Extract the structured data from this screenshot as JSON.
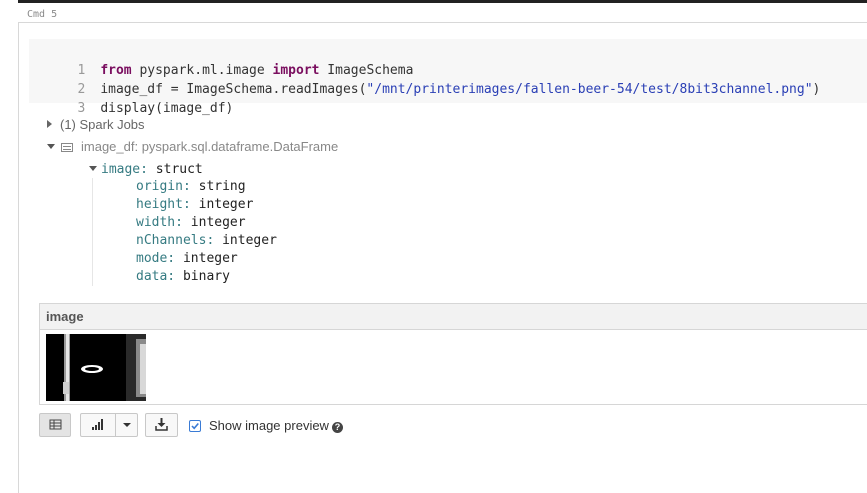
{
  "cell": {
    "cmd_label": "Cmd 5",
    "code_lines": [
      {
        "num": "1",
        "kw1": "from",
        "t1": " pyspark.ml.image ",
        "kw2": "import",
        "t2": " ImageSchema",
        "t3": "",
        "str": "",
        "t4": ""
      },
      {
        "num": "2",
        "kw1": "",
        "t1": "",
        "kw2": "",
        "t2": "",
        "t3": "image_df = ImageSchema.readImages(",
        "str": "\"/mnt/printerimages/fallen-beer-54/test/8bit3channel.png\"",
        "t4": ")"
      },
      {
        "num": "3",
        "kw1": "",
        "t1": "",
        "kw2": "",
        "t2": "",
        "t3": "display(image_df)",
        "str": "",
        "t4": ""
      }
    ]
  },
  "output": {
    "spark_jobs_label": "(1) Spark Jobs",
    "dataframe_label": "image_df:  pyspark.sql.dataframe.DataFrame",
    "schema": {
      "root_name": "image:",
      "root_type": " struct",
      "fields": [
        {
          "name": "origin:",
          "type": " string"
        },
        {
          "name": "height:",
          "type": " integer"
        },
        {
          "name": "width:",
          "type": " integer"
        },
        {
          "name": "nChannels:",
          "type": " integer"
        },
        {
          "name": "mode:",
          "type": " integer"
        },
        {
          "name": "data:",
          "type": " binary"
        }
      ]
    },
    "table": {
      "column_header": "image"
    }
  },
  "toolbar": {
    "table_view_icon": "table-icon",
    "chart_icon": "bar-chart-icon",
    "dropdown_icon": "caret-down-icon",
    "download_icon": "download-icon",
    "show_preview_label": "Show image preview",
    "show_preview_checked": true
  },
  "colors": {
    "keyword": "#7a0e5f",
    "string": "#2a3fb5",
    "schema_field": "#367b82",
    "checkbox": "#3a7bd5"
  }
}
